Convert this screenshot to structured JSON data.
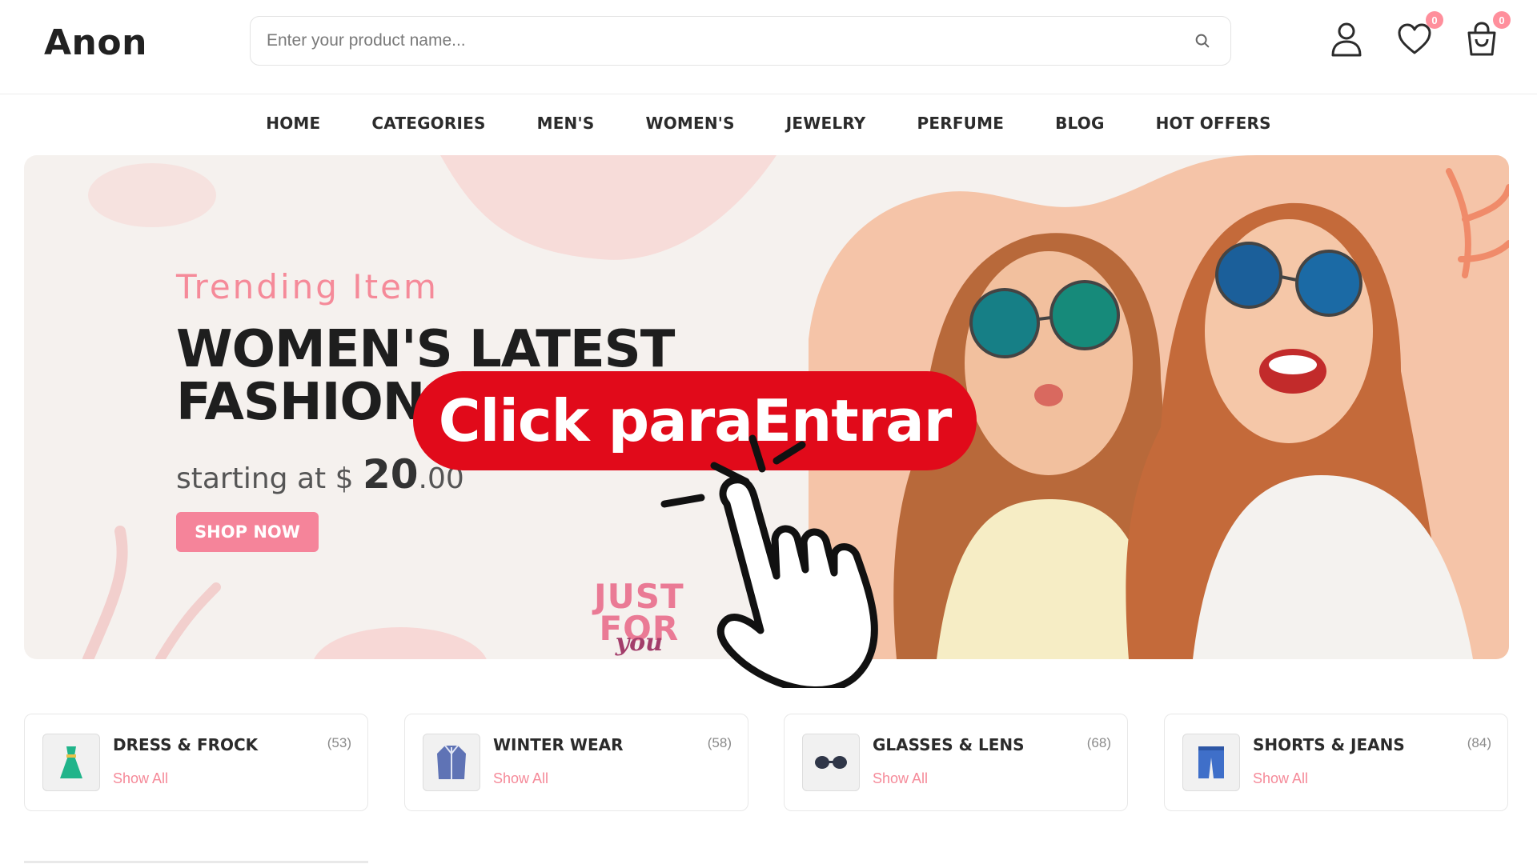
{
  "header": {
    "logo": "Anon",
    "search_placeholder": "Enter your product name...",
    "wishlist_count": "0",
    "cart_count": "0"
  },
  "nav": {
    "items": [
      "HOME",
      "CATEGORIES",
      "MEN'S",
      "WOMEN'S",
      "JEWELRY",
      "PERFUME",
      "BLOG",
      "HOT OFFERS"
    ]
  },
  "banner": {
    "subtitle": "Trending Item",
    "title_line1": "WOMEN'S LATEST",
    "title_line2": "FASHION SALE",
    "price_prefix": "starting at $",
    "price_main": "20",
    "price_cents": ".00",
    "button": "SHOP NOW",
    "badge_line1": "JUST",
    "badge_line2": "FOR",
    "badge_line3": "you"
  },
  "overlay": {
    "cta_label": "Click paraEntrar"
  },
  "categories": [
    {
      "title": "DRESS & FROCK",
      "count": "(53)",
      "link": "Show All",
      "icon": "dress-icon"
    },
    {
      "title": "WINTER WEAR",
      "count": "(58)",
      "link": "Show All",
      "icon": "coat-icon"
    },
    {
      "title": "GLASSES & LENS",
      "count": "(68)",
      "link": "Show All",
      "icon": "glasses-icon"
    },
    {
      "title": "SHORTS & JEANS",
      "count": "(84)",
      "link": "Show All",
      "icon": "shorts-icon"
    }
  ],
  "colors": {
    "accent_pink": "#f5849a",
    "cta_red": "#e10a1a",
    "text_dark": "#212121"
  }
}
